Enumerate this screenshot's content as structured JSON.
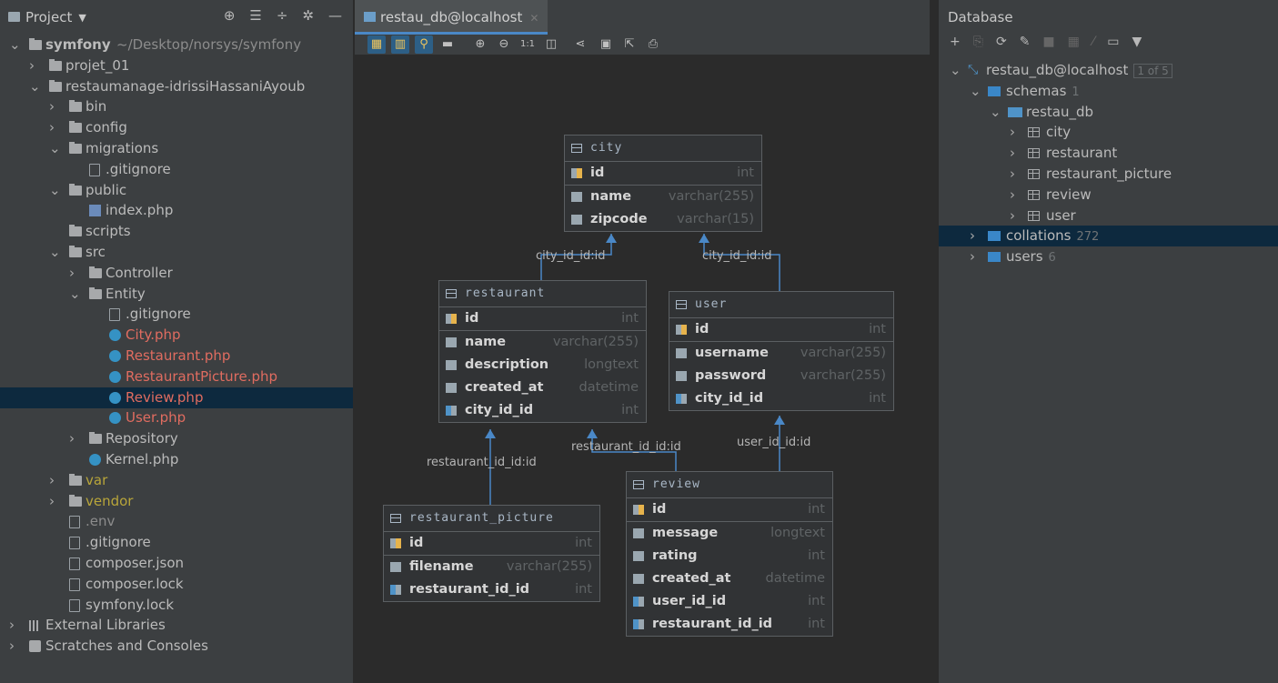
{
  "project": {
    "title": "Project",
    "tree": [
      {
        "label": "symfony",
        "suffix": "~/Desktop/norsys/symfony",
        "level": 0,
        "expanded": true,
        "icon": "folder",
        "bold": true
      },
      {
        "label": "projet_01",
        "level": 1,
        "expanded": false,
        "icon": "folder"
      },
      {
        "label": "restaumanage-idrissiHassaniAyoub",
        "level": 1,
        "expanded": true,
        "icon": "folder"
      },
      {
        "label": "bin",
        "level": 2,
        "expanded": false,
        "icon": "folder"
      },
      {
        "label": "config",
        "level": 2,
        "expanded": false,
        "icon": "folder"
      },
      {
        "label": "migrations",
        "level": 2,
        "expanded": true,
        "icon": "folder"
      },
      {
        "label": ".gitignore",
        "level": 3,
        "icon": "file"
      },
      {
        "label": "public",
        "level": 2,
        "expanded": true,
        "icon": "folder"
      },
      {
        "label": "index.php",
        "level": 3,
        "icon": "php"
      },
      {
        "label": "scripts",
        "level": 2,
        "icon": "folder"
      },
      {
        "label": "src",
        "level": 2,
        "expanded": true,
        "icon": "folder"
      },
      {
        "label": "Controller",
        "level": 3,
        "expanded": false,
        "icon": "folder"
      },
      {
        "label": "Entity",
        "level": 3,
        "expanded": true,
        "icon": "folder"
      },
      {
        "label": ".gitignore",
        "level": 4,
        "icon": "file"
      },
      {
        "label": "City.php",
        "level": 4,
        "icon": "class",
        "color": "red"
      },
      {
        "label": "Restaurant.php",
        "level": 4,
        "icon": "class",
        "color": "red"
      },
      {
        "label": "RestaurantPicture.php",
        "level": 4,
        "icon": "class",
        "color": "red"
      },
      {
        "label": "Review.php",
        "level": 4,
        "icon": "class",
        "color": "red",
        "selected": true
      },
      {
        "label": "User.php",
        "level": 4,
        "icon": "class",
        "color": "red"
      },
      {
        "label": "Repository",
        "level": 3,
        "expanded": false,
        "icon": "folder"
      },
      {
        "label": "Kernel.php",
        "level": 3,
        "icon": "class"
      },
      {
        "label": "var",
        "level": 2,
        "expanded": false,
        "icon": "folder",
        "color": "olive"
      },
      {
        "label": "vendor",
        "level": 2,
        "expanded": false,
        "icon": "folder",
        "color": "olive"
      },
      {
        "label": ".env",
        "level": 2,
        "icon": "file",
        "color": "gray"
      },
      {
        "label": ".gitignore",
        "level": 2,
        "icon": "file"
      },
      {
        "label": "composer.json",
        "level": 2,
        "icon": "file"
      },
      {
        "label": "composer.lock",
        "level": 2,
        "icon": "file"
      },
      {
        "label": "symfony.lock",
        "level": 2,
        "icon": "file"
      },
      {
        "label": "External Libraries",
        "level": 0,
        "expanded": false,
        "icon": "lib"
      },
      {
        "label": "Scratches and Consoles",
        "level": 0,
        "expanded": false,
        "icon": "scratch"
      }
    ]
  },
  "editor": {
    "tab_label": "restau_db@localhost",
    "toolbar_zoom": "1:1",
    "tables": [
      {
        "name": "city",
        "columns": [
          {
            "name": "id",
            "type": "int",
            "kind": "key"
          },
          {
            "name": "name",
            "type": "varchar(255)",
            "kind": "col"
          },
          {
            "name": "zipcode",
            "type": "varchar(15)",
            "kind": "col"
          }
        ]
      },
      {
        "name": "restaurant",
        "columns": [
          {
            "name": "id",
            "type": "int",
            "kind": "key"
          },
          {
            "name": "name",
            "type": "varchar(255)",
            "kind": "col"
          },
          {
            "name": "description",
            "type": "longtext",
            "kind": "col"
          },
          {
            "name": "created_at",
            "type": "datetime",
            "kind": "col"
          },
          {
            "name": "city_id_id",
            "type": "int",
            "kind": "fk"
          }
        ]
      },
      {
        "name": "user",
        "columns": [
          {
            "name": "id",
            "type": "int",
            "kind": "key"
          },
          {
            "name": "username",
            "type": "varchar(255)",
            "kind": "col"
          },
          {
            "name": "password",
            "type": "varchar(255)",
            "kind": "col"
          },
          {
            "name": "city_id_id",
            "type": "int",
            "kind": "fk"
          }
        ]
      },
      {
        "name": "restaurant_picture",
        "columns": [
          {
            "name": "id",
            "type": "int",
            "kind": "key"
          },
          {
            "name": "filename",
            "type": "varchar(255)",
            "kind": "col"
          },
          {
            "name": "restaurant_id_id",
            "type": "int",
            "kind": "fk"
          }
        ]
      },
      {
        "name": "review",
        "columns": [
          {
            "name": "id",
            "type": "int",
            "kind": "key"
          },
          {
            "name": "message",
            "type": "longtext",
            "kind": "col"
          },
          {
            "name": "rating",
            "type": "int",
            "kind": "col"
          },
          {
            "name": "created_at",
            "type": "datetime",
            "kind": "col"
          },
          {
            "name": "user_id_id",
            "type": "int",
            "kind": "fk"
          },
          {
            "name": "restaurant_id_id",
            "type": "int",
            "kind": "fk"
          }
        ]
      }
    ],
    "relations": [
      "city_id_id:id",
      "city_id_id:id",
      "restaurant_id_id:id",
      "restaurant_id_id:id",
      "user_id_id:id"
    ]
  },
  "database": {
    "title": "Database",
    "tree": [
      {
        "label": "restau_db@localhost",
        "badge": "1 of 5",
        "level": 0,
        "icon": "conn",
        "expanded": true
      },
      {
        "label": "schemas",
        "count": "1",
        "level": 1,
        "icon": "dbfolder",
        "expanded": true
      },
      {
        "label": "restau_db",
        "level": 2,
        "icon": "schema",
        "expanded": true
      },
      {
        "label": "city",
        "level": 3,
        "icon": "table",
        "expanded": false
      },
      {
        "label": "restaurant",
        "level": 3,
        "icon": "table",
        "expanded": false
      },
      {
        "label": "restaurant_picture",
        "level": 3,
        "icon": "table",
        "expanded": false
      },
      {
        "label": "review",
        "level": 3,
        "icon": "table",
        "expanded": false
      },
      {
        "label": "user",
        "level": 3,
        "icon": "table",
        "expanded": false
      },
      {
        "label": "collations",
        "count": "272",
        "level": 1,
        "icon": "dbfolder",
        "expanded": false,
        "selected": true
      },
      {
        "label": "users",
        "count": "6",
        "level": 1,
        "icon": "dbfolder",
        "expanded": false
      }
    ]
  }
}
